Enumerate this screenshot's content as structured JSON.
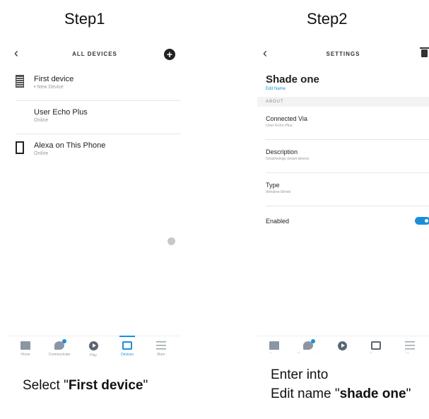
{
  "steps": {
    "step1": "Step1",
    "step2": "Step2"
  },
  "screen1": {
    "header_title": "ALL DEVICES",
    "devices": [
      {
        "name": "First device",
        "status": "New Device",
        "icon": "blinds-icon"
      },
      {
        "name": "User Echo Plus",
        "status": "Online",
        "icon": "echo-speaker-icon"
      },
      {
        "name": "Alexa on This Phone",
        "status": "Online",
        "icon": "phone-icon"
      }
    ]
  },
  "screen2": {
    "header_title": "SETTINGS",
    "device_name": "Shade one",
    "edit_name": "Edit Name",
    "section": "ABOUT",
    "rows": [
      {
        "label": "Connected Via",
        "value": "User Echo Plus"
      },
      {
        "label": "Description",
        "value": "Smartwings smart device"
      },
      {
        "label": "Type",
        "value": "Window blinds"
      }
    ],
    "enabled_label": "Enabled",
    "enabled": true
  },
  "tabs": [
    "Home",
    "Communicate",
    "Play",
    "Devices",
    "More"
  ],
  "captions": {
    "cap1_prefix": "Select \"",
    "cap1_bold": "First device",
    "cap1_suffix": "\"",
    "cap2_line1": "Enter into",
    "cap2_prefix": "Edit name \"",
    "cap2_bold": "shade one",
    "cap2_suffix": "\""
  },
  "colors": {
    "accent": "#1a8fd8"
  }
}
